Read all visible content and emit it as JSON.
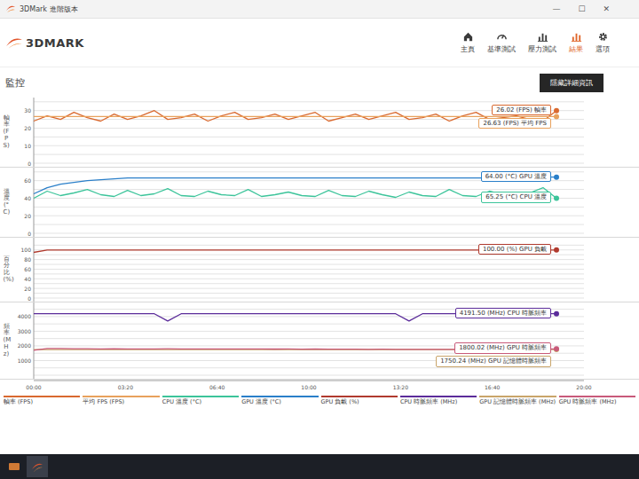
{
  "window": {
    "title": "3DMark 進階版本",
    "controls": [
      "—",
      "☐",
      "✕"
    ]
  },
  "logo": "3DMARK",
  "nav": [
    {
      "label": "主頁",
      "selected": false
    },
    {
      "label": "基準測試",
      "selected": false
    },
    {
      "label": "壓力測試",
      "selected": false
    },
    {
      "label": "結果",
      "selected": true
    },
    {
      "label": "選項",
      "selected": false
    }
  ],
  "section": {
    "title": "監控",
    "button": "隱藏詳細資訊"
  },
  "chart": {
    "panels": [
      {
        "axis_title": "幀率 (FPS)",
        "ticks": [
          "30",
          "20",
          "10",
          "0"
        ],
        "series": [
          {
            "legend": "幀率 (FPS)",
            "reading": "26.02 (FPS) 幀率",
            "color": "#d9692f",
            "values": [
              24,
              27,
              25,
              29,
              26,
              24,
              28,
              25,
              27,
              30,
              25,
              26,
              28,
              24,
              27,
              29,
              25,
              26,
              28,
              25,
              27,
              29,
              24,
              26,
              28,
              25,
              27,
              29,
              25,
              26,
              28,
              24,
              27,
              29,
              25,
              26,
              27,
              25,
              24,
              30
            ]
          },
          {
            "legend": "平均 FPS (FPS)",
            "reading": "26.63 (FPS) 平均 FPS",
            "color": "#e8a15c",
            "values": [
              26.6,
              26.6,
              26.6,
              26.6,
              26.6,
              26.6,
              26.6,
              26.6,
              26.6,
              26.6,
              26.6,
              26.6,
              26.6,
              26.6,
              26.6,
              26.6,
              26.6,
              26.6,
              26.6,
              26.6,
              26.6,
              26.6,
              26.6,
              26.6,
              26.6,
              26.6,
              26.6,
              26.6,
              26.6,
              26.6,
              26.6,
              26.6,
              26.6,
              26.6,
              26.6,
              26.6,
              26.6,
              26.6,
              26.6,
              26.6
            ]
          }
        ]
      },
      {
        "axis_title": "溫度 (°C)",
        "ticks": [
          "60",
          "40",
          "20",
          "0"
        ],
        "series": [
          {
            "legend": "CPU 溫度 (°C)",
            "reading": "65.25 (°C) CPU 溫度",
            "color": "#3cc49a",
            "values": [
              40,
              48,
              43,
              46,
              50,
              44,
              42,
              49,
              43,
              45,
              51,
              43,
              42,
              48,
              44,
              43,
              50,
              42,
              44,
              47,
              43,
              42,
              49,
              43,
              42,
              48,
              44,
              41,
              47,
              43,
              42,
              50,
              43,
              42,
              48,
              44,
              41,
              46,
              52,
              40
            ]
          },
          {
            "legend": "GPU 溫度 (°C)",
            "reading": "64.00 (°C) GPU 溫度",
            "color": "#2a7fc9",
            "values": [
              45,
              52,
              56,
              58,
              60,
              61,
              62,
              63,
              63,
              63,
              63,
              63,
              63,
              63,
              63,
              63,
              63,
              63,
              63,
              63,
              63,
              63,
              63,
              63,
              63,
              63,
              63,
              63,
              63,
              63,
              63,
              63,
              63,
              63,
              63,
              63,
              63,
              64,
              64,
              64
            ]
          }
        ]
      },
      {
        "axis_title": "百分比 (%)",
        "ticks": [
          "100",
          "80",
          "60",
          "40",
          "20",
          "0"
        ],
        "series": [
          {
            "legend": "GPU 負載 (%)",
            "reading": "100.00 (%) GPU 負載",
            "color": "#b03a2e",
            "values": [
              95,
              100,
              100,
              100,
              100,
              100,
              100,
              100,
              100,
              100,
              100,
              100,
              100,
              100,
              100,
              100,
              100,
              100,
              100,
              100,
              100,
              100,
              100,
              100,
              100,
              100,
              100,
              100,
              100,
              100,
              100,
              100,
              100,
              100,
              100,
              100,
              100,
              100,
              100,
              100
            ]
          }
        ]
      },
      {
        "axis_title": "頻率 (MHz)",
        "ticks": [
          "4000",
          "3000",
          "2000",
          "1000"
        ],
        "series": [
          {
            "legend": "CPU 時脈頻率 (MHz)",
            "reading": "4191.50 (MHz) CPU 時脈頻率",
            "color": "#5b2c9a",
            "values": [
              4191,
              4191,
              4191,
              4191,
              4191,
              4191,
              4191,
              4191,
              4191,
              4191,
              3700,
              4191,
              4191,
              4191,
              4191,
              4191,
              4191,
              4191,
              4191,
              4191,
              4191,
              4191,
              4191,
              4191,
              4191,
              4191,
              4191,
              4191,
              3700,
              4191,
              4191,
              4191,
              4191,
              4191,
              4191,
              4191,
              4191,
              4191,
              4191,
              4191
            ]
          },
          {
            "legend": "GPU 記憶體時脈頻率 (MHz)",
            "reading": "1750.24 (MHz) GPU 記憶體時脈頻率",
            "color": "#c9a56a",
            "values": [
              1750,
              1750,
              1750,
              1750,
              1750,
              1750,
              1750,
              1750,
              1750,
              1750,
              1750,
              1750,
              1750,
              1750,
              1750,
              1750,
              1750,
              1750,
              1750,
              1750,
              1750,
              1750,
              1750,
              1750,
              1750,
              1750,
              1750,
              1750,
              1750,
              1750,
              1750,
              1750,
              1750,
              1750,
              1750,
              1750,
              1750,
              1750,
              1750,
              1750
            ]
          },
          {
            "legend": "GPU 時脈頻率 (MHz)",
            "reading": "1800.02 (MHz) GPU 時脈頻率",
            "color": "#c85a7a",
            "values": [
              1700,
              1830,
              1820,
              1810,
              1805,
              1800,
              1810,
              1800,
              1795,
              1800,
              1805,
              1800,
              1790,
              1800,
              1800,
              1795,
              1800,
              1790,
              1785,
              1790,
              1780,
              1785,
              1780,
              1775,
              1780,
              1770,
              1775,
              1770,
              1765,
              1770,
              1760,
              1765,
              1760,
              1755,
              1760,
              1755,
              1750,
              1760,
              1790,
              1800
            ]
          }
        ]
      }
    ],
    "x_ticks": [
      "00:00",
      "03:20",
      "06:40",
      "10:00",
      "13:20",
      "16:40",
      "20:00"
    ]
  }
}
